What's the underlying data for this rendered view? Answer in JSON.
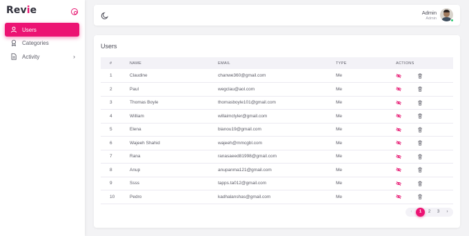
{
  "brand": {
    "prefix": "Rev",
    "accent": "i",
    "suffix": "e",
    "accent_color": "#e6116e"
  },
  "sidebar": {
    "items": [
      {
        "label": "Users",
        "icon": "user-icon",
        "active": true
      },
      {
        "label": "Categories",
        "icon": "award-icon",
        "active": false
      },
      {
        "label": "Activity",
        "icon": "file-icon",
        "active": false,
        "has_submenu": true
      }
    ]
  },
  "topbar": {
    "theme_icon": "moon-icon",
    "user_name": "Admin",
    "user_role": "Admin",
    "status_color": "#28c76f"
  },
  "users_card": {
    "title": "Users",
    "columns": [
      "#",
      "NAME",
      "EMAIL",
      "TYPE",
      "ACTIONS"
    ],
    "rows": [
      {
        "num": "1",
        "name": "Claudine",
        "email": "chanwe360@gmail.com",
        "type": "Me"
      },
      {
        "num": "2",
        "name": "Paul",
        "email": "wegclau@aol.com",
        "type": "Me"
      },
      {
        "num": "3",
        "name": "Thomas Boyle",
        "email": "thomasboyle101@gmail.com",
        "type": "Me"
      },
      {
        "num": "4",
        "name": "William",
        "email": "willaimctyler@gmail.com",
        "type": "Me"
      },
      {
        "num": "5",
        "name": "Elena",
        "email": "bianou19@gmail.com",
        "type": "Me"
      },
      {
        "num": "6",
        "name": "Wajeeh Shahid",
        "email": "wajeeh@mmcgbl.com",
        "type": "Me"
      },
      {
        "num": "7",
        "name": "Rana",
        "email": "ranasaeed81998@gmail.com",
        "type": "Me"
      },
      {
        "num": "8",
        "name": "Anup",
        "email": "anupanma121@gmail.com",
        "type": "Me"
      },
      {
        "num": "9",
        "name": "Ssss",
        "email": "tapps.ta012@gmail.com",
        "type": "Me"
      },
      {
        "num": "10",
        "name": "Pedro",
        "email": "kadhalanshas@gmail.com",
        "type": "Me"
      }
    ],
    "row_actions": {
      "hide_icon": "eye-off-icon",
      "delete_icon": "trash-icon",
      "hide_color": "#e6116e"
    }
  },
  "pagination": {
    "prev": "‹",
    "pages": [
      "1",
      "2",
      "3"
    ],
    "current": "1",
    "next": "›",
    "accent_color": "#ec1373"
  }
}
